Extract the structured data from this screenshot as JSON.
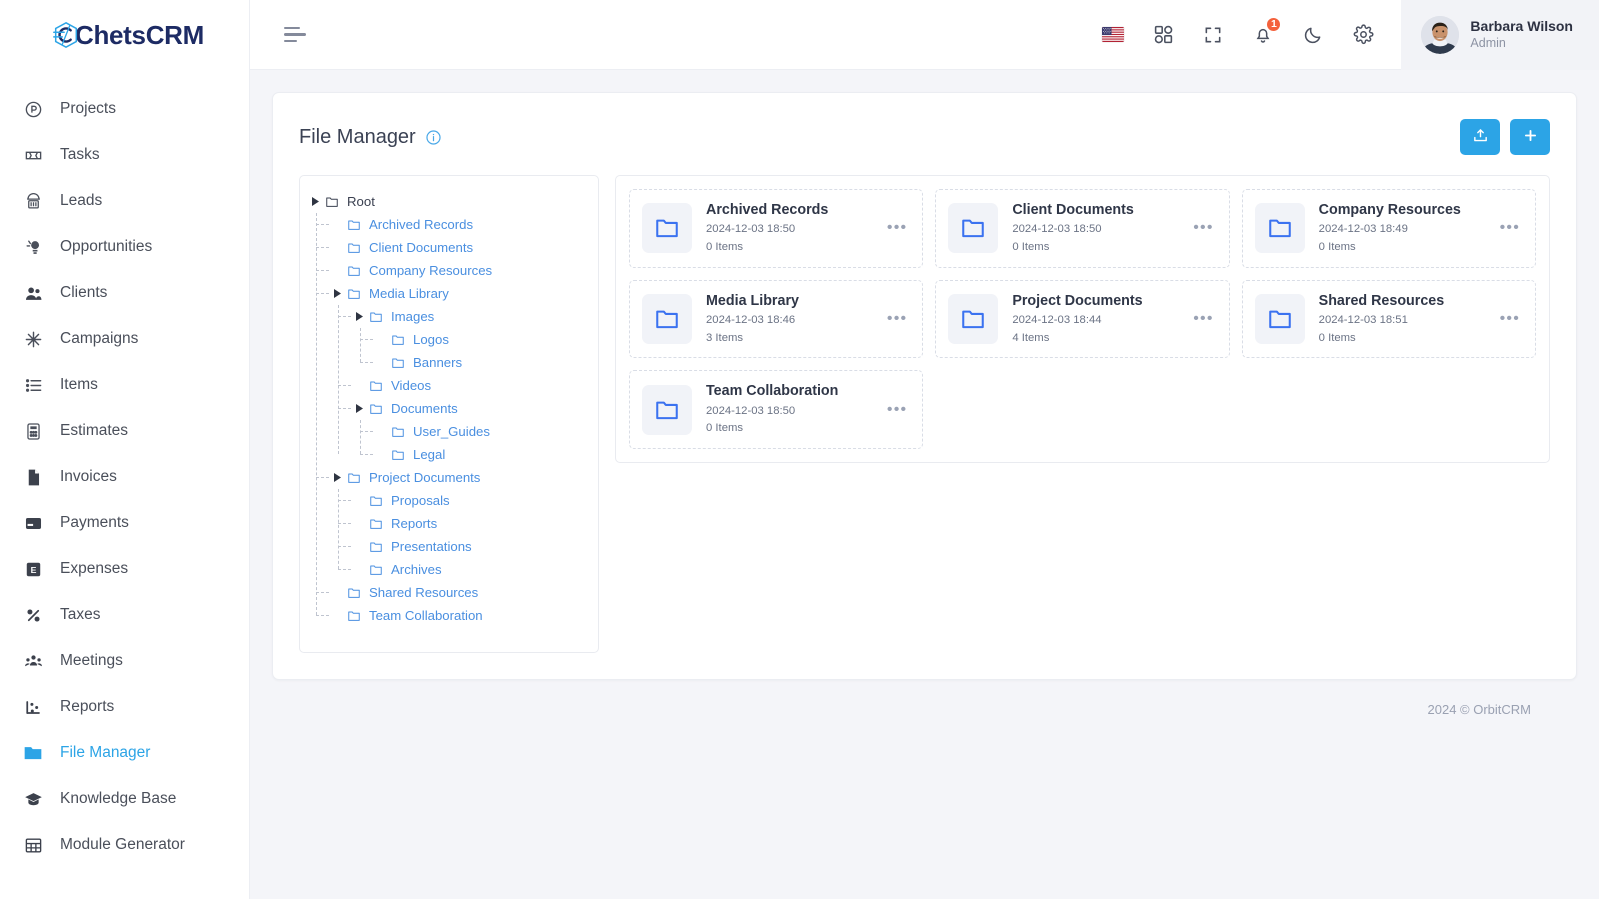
{
  "brand": {
    "name": "ChetsCRM",
    "logo_icon": "crm-logo-icon",
    "accent": "#2ca4e6",
    "text_color": "#1d2b64"
  },
  "sidebar": {
    "items": [
      {
        "label": "Projects",
        "icon": "projects-icon",
        "active": false
      },
      {
        "label": "Tasks",
        "icon": "tasks-icon",
        "active": false
      },
      {
        "label": "Leads",
        "icon": "leads-icon",
        "active": false
      },
      {
        "label": "Opportunities",
        "icon": "opportunities-icon",
        "active": false
      },
      {
        "label": "Clients",
        "icon": "clients-icon",
        "active": false
      },
      {
        "label": "Campaigns",
        "icon": "campaigns-icon",
        "active": false
      },
      {
        "label": "Items",
        "icon": "items-icon",
        "active": false
      },
      {
        "label": "Estimates",
        "icon": "estimates-icon",
        "active": false
      },
      {
        "label": "Invoices",
        "icon": "invoices-icon",
        "active": false
      },
      {
        "label": "Payments",
        "icon": "payments-icon",
        "active": false
      },
      {
        "label": "Expenses",
        "icon": "expenses-icon",
        "active": false
      },
      {
        "label": "Taxes",
        "icon": "taxes-icon",
        "active": false
      },
      {
        "label": "Meetings",
        "icon": "meetings-icon",
        "active": false
      },
      {
        "label": "Reports",
        "icon": "reports-icon",
        "active": false
      },
      {
        "label": "File Manager",
        "icon": "folder-icon",
        "active": true
      },
      {
        "label": "Knowledge Base",
        "icon": "knowledge-base-icon",
        "active": false
      },
      {
        "label": "Module Generator",
        "icon": "module-generator-icon",
        "active": false
      }
    ]
  },
  "topbar": {
    "menu_toggle_icon": "hamburger-icon",
    "icons": [
      {
        "name": "language-flag-icon",
        "label": "US"
      },
      {
        "name": "apps-grid-icon",
        "label": "Apps"
      },
      {
        "name": "fullscreen-icon",
        "label": "Fullscreen"
      },
      {
        "name": "notifications-bell-icon",
        "label": "Notifications",
        "badge": "1"
      },
      {
        "name": "dark-mode-moon-icon",
        "label": "Dark mode"
      },
      {
        "name": "settings-gear-icon",
        "label": "Settings"
      }
    ],
    "notification_count": "1",
    "user": {
      "name": "Barbara Wilson",
      "role": "Admin",
      "avatar": "user-avatar"
    }
  },
  "page": {
    "title": "File Manager",
    "info_icon": "info-circle-icon",
    "actions": [
      {
        "name": "upload-button",
        "icon": "upload-icon",
        "label": "Upload"
      },
      {
        "name": "add-folder-button",
        "icon": "plus-icon",
        "label": "Add"
      }
    ]
  },
  "tree": {
    "root": {
      "label": "Root",
      "expanded": true
    },
    "nodes": [
      {
        "label": "Archived Records",
        "depth": 1,
        "caret": false
      },
      {
        "label": "Client Documents",
        "depth": 1,
        "caret": false
      },
      {
        "label": "Company Resources",
        "depth": 1,
        "caret": false
      },
      {
        "label": "Media Library",
        "depth": 1,
        "caret": true
      },
      {
        "label": "Images",
        "depth": 2,
        "caret": true
      },
      {
        "label": "Logos",
        "depth": 3,
        "caret": false
      },
      {
        "label": "Banners",
        "depth": 3,
        "caret": false
      },
      {
        "label": "Videos",
        "depth": 2,
        "caret": false
      },
      {
        "label": "Documents",
        "depth": 2,
        "caret": true
      },
      {
        "label": "User_Guides",
        "depth": 3,
        "caret": false
      },
      {
        "label": "Legal",
        "depth": 3,
        "caret": false
      },
      {
        "label": "Project Documents",
        "depth": 1,
        "caret": true
      },
      {
        "label": "Proposals",
        "depth": 2,
        "caret": false
      },
      {
        "label": "Reports",
        "depth": 2,
        "caret": false
      },
      {
        "label": "Presentations",
        "depth": 2,
        "caret": false
      },
      {
        "label": "Archives",
        "depth": 2,
        "caret": false
      },
      {
        "label": "Shared Resources",
        "depth": 1,
        "caret": false
      },
      {
        "label": "Team Collaboration",
        "depth": 1,
        "caret": false
      }
    ]
  },
  "folders": [
    {
      "name": "Archived Records",
      "date": "2024-12-03 18:50",
      "items": "0 Items"
    },
    {
      "name": "Client Documents",
      "date": "2024-12-03 18:50",
      "items": "0 Items"
    },
    {
      "name": "Company Resources",
      "date": "2024-12-03 18:49",
      "items": "0 Items"
    },
    {
      "name": "Media Library",
      "date": "2024-12-03 18:46",
      "items": "3 Items"
    },
    {
      "name": "Project Documents",
      "date": "2024-12-03 18:44",
      "items": "4 Items"
    },
    {
      "name": "Shared Resources",
      "date": "2024-12-03 18:51",
      "items": "0 Items"
    },
    {
      "name": "Team Collaboration",
      "date": "2024-12-03 18:50",
      "items": "0 Items"
    }
  ],
  "card_menu_glyph": "•••",
  "footer": {
    "text": "2024 © OrbitCRM"
  }
}
